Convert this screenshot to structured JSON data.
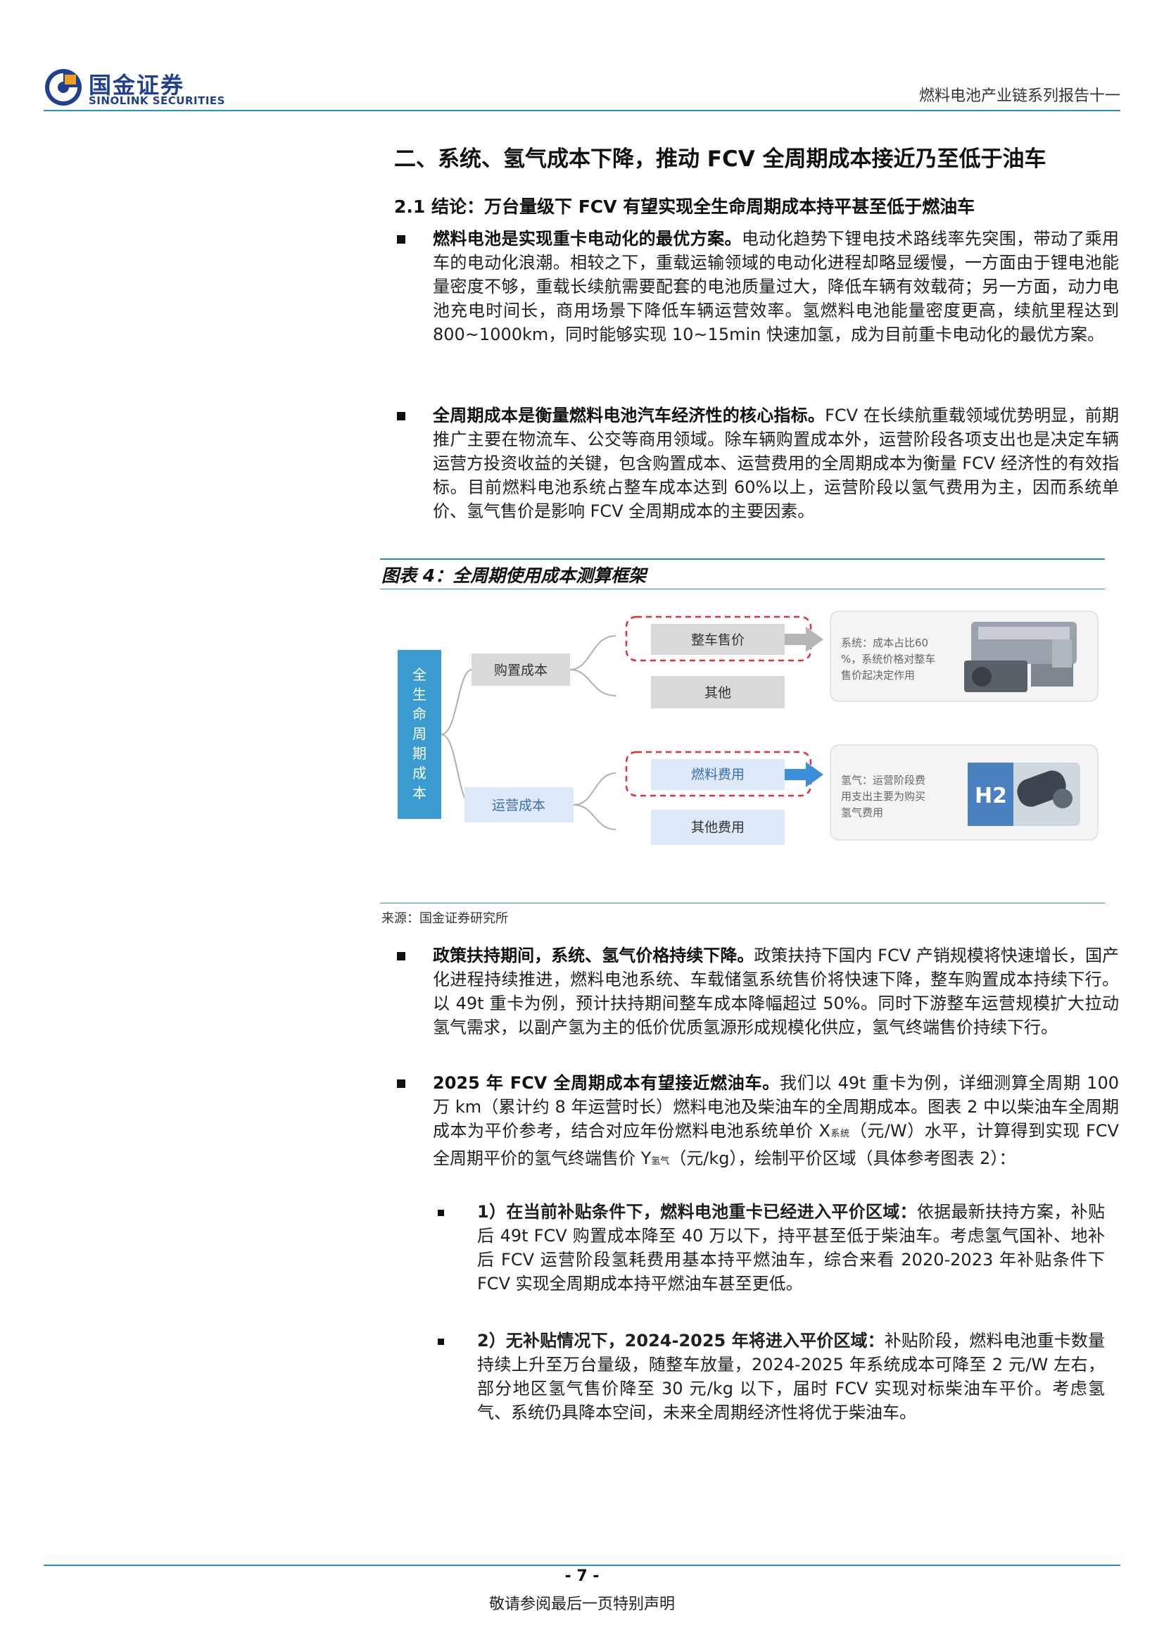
{
  "header": {
    "logo_cn": "国金证券",
    "logo_en": "SINOLINK SECURITIES",
    "report_title": "燃料电池产业链系列报告十一"
  },
  "section_heading": "二、系统、氢气成本下降，推动 FCV 全周期成本接近乃至低于油车",
  "subsection_heading": "2.1 结论：万台量级下 FCV 有望实现全生命周期成本持平甚至低于燃油车",
  "paragraphs": [
    {
      "lead": "燃料电池是实现重卡电动化的最优方案。",
      "body": "电动化趋势下锂电技术路线率先突围，带动了乘用车的电动化浪潮。相较之下，重载运输领域的电动化进程却略显缓慢，一方面由于锂电池能量密度不够，重载长续航需要配套的电池质量过大，降低车辆有效载荷；另一方面，动力电池充电时间长，商用场景下降低车辆运营效率。氢燃料电池能量密度更高，续航里程达到 800~1000km，同时能够实现 10~15min 快速加氢，成为目前重卡电动化的最优方案。"
    },
    {
      "lead": "全周期成本是衡量燃料电池汽车经济性的核心指标。",
      "body": "FCV 在长续航重载领域优势明显，前期推广主要在物流车、公交等商用领域。除车辆购置成本外，运营阶段各项支出也是决定车辆运营方投资收益的关键，包含购置成本、运营费用的全周期成本为衡量 FCV 经济性的有效指标。目前燃料电池系统占整车成本达到 60%以上，运营阶段以氢气费用为主，因而系统单价、氢气售价是影响 FCV 全周期成本的主要因素。"
    },
    {
      "lead": "政策扶持期间，系统、氢气价格持续下降。",
      "body": "政策扶持下国内 FCV 产销规模将快速增长，国产化进程持续推进，燃料电池系统、车载储氢系统售价将快速下降，整车购置成本持续下行。以 49t 重卡为例，预计扶持期间整车成本降幅超过 50%。同时下游整车运营规模扩大拉动氢气需求，以副产氢为主的低价优质氢源形成规模化供应，氢气终端售价持续下行。"
    }
  ],
  "para4": {
    "lead": "2025 年 FCV 全周期成本有望接近燃油车。",
    "body_a": "我们以 49t 重卡为例，详细测算全周期 100 万 km（累计约 8 年运营时长）燃料电池及柴油车的全周期成本。图表 2 中以柴油车全周期成本为平价参考，结合对应年份燃料电池系统单价 X",
    "sub_x": "系统",
    "body_b": "（元/W）水平，计算得到实现 FCV 全周期平价的氢气终端售价 Y",
    "sub_y": "氢气",
    "body_c": "（元/kg），绘制平价区域（具体参考图表 2）："
  },
  "sub_points": [
    {
      "lead": "1）在当前补贴条件下，燃料电池重卡已经进入平价区域：",
      "body": "依据最新扶持方案，补贴后 49t FCV 购置成本降至 40 万以下，持平甚至低于柴油车。考虑氢气国补、地补后 FCV 运营阶段氢耗费用基本持平燃油车，综合来看 2020-2023 年补贴条件下 FCV 实现全周期成本持平燃油车甚至更低。"
    },
    {
      "lead": "2）无补贴情况下，2024-2025 年将进入平价区域：",
      "body": "补贴阶段，燃料电池重卡数量持续上升至万台量级，随整车放量，2024-2025 年系统成本可降至 2 元/W 左右，部分地区氢气售价降至 30 元/kg 以下，届时 FCV 实现对标柴油车平价。考虑氢气、系统仍具降本空间，未来全周期经济性将优于柴油车。"
    }
  ],
  "figure": {
    "caption": "图表 4：全周期使用成本测算框架",
    "root_label": "全生命周期成本",
    "purchase_cost": "购置成本",
    "operating_cost": "运营成本",
    "vehicle_price": "整车售价",
    "other": "其他",
    "fuel_cost": "燃料费用",
    "other_cost": "其他费用",
    "system_note": "系统：成本占比60%，系统价格对整车售价起决定作用",
    "hydrogen_note": "氢气：运营阶段费用支出主要为购买氢气费用",
    "h2_label": "H2",
    "source": "来源：国金证券研究所"
  },
  "footer": {
    "page_number": "- 7 -",
    "note": "敬请参阅最后一页特别声明"
  },
  "colors": {
    "brand_blue": "#1f3f8f",
    "rule_blue": "#2a8fc6",
    "root_box": "#3a9bd1",
    "grey_box": "#d9d9d9",
    "light_blue_box": "#dde8f8",
    "dashed_red": "#e0303a"
  }
}
